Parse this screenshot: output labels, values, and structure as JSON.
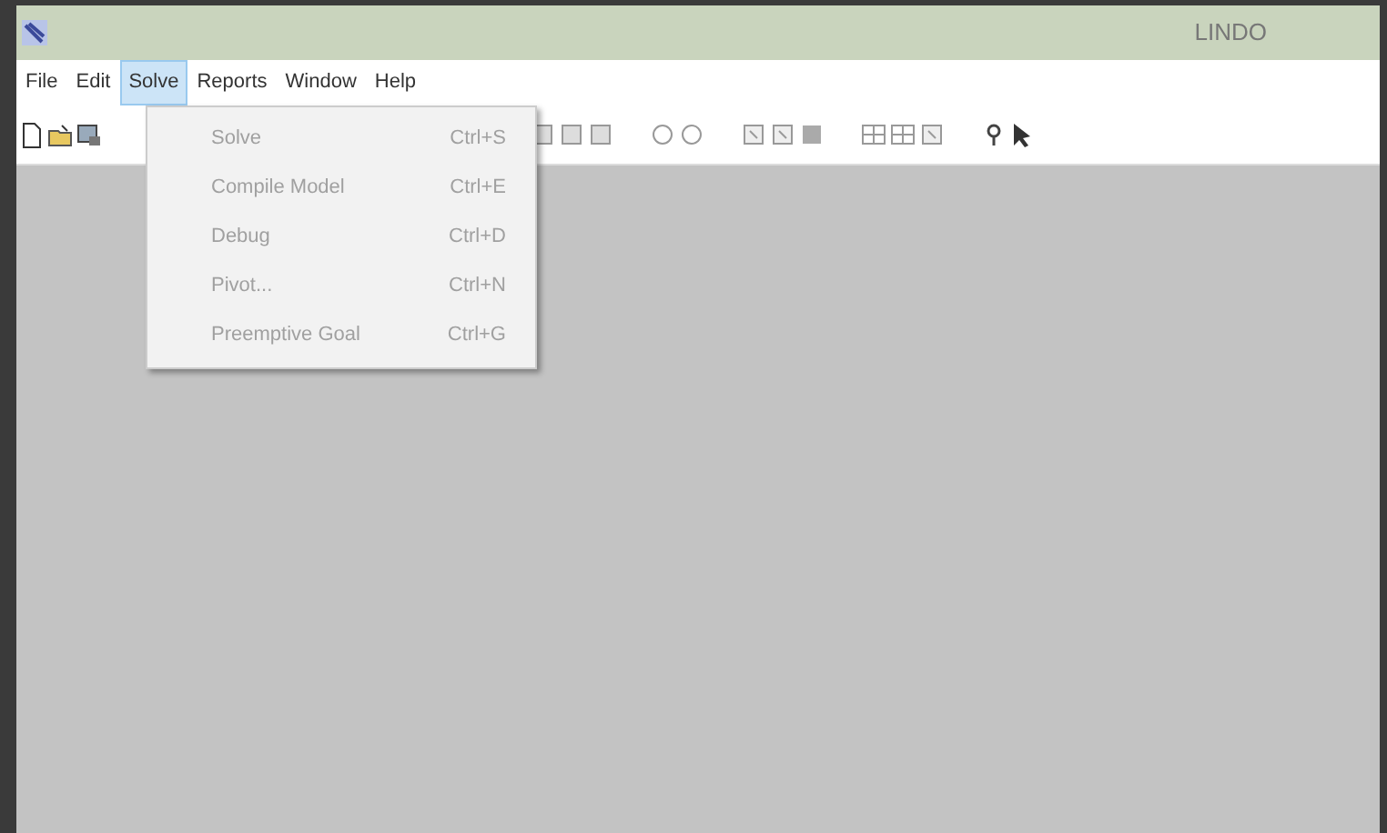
{
  "window": {
    "title": "LINDO"
  },
  "menu_bar": [
    {
      "label": "File",
      "selected": false
    },
    {
      "label": "Edit",
      "selected": false
    },
    {
      "label": "Solve",
      "selected": true
    },
    {
      "label": "Reports",
      "selected": false
    },
    {
      "label": "Window",
      "selected": false
    },
    {
      "label": "Help",
      "selected": false
    }
  ],
  "dropdown": [
    {
      "label": "Solve",
      "shortcut": "Ctrl+S",
      "disabled": true
    },
    {
      "label": "Compile Model",
      "shortcut": "Ctrl+E",
      "disabled": true
    },
    {
      "label": "Debug",
      "shortcut": "Ctrl+D",
      "disabled": true
    },
    {
      "label": "Pivot...",
      "shortcut": "Ctrl+N",
      "disabled": true
    },
    {
      "label": "Preemptive Goal",
      "shortcut": "Ctrl+G",
      "disabled": true
    }
  ]
}
